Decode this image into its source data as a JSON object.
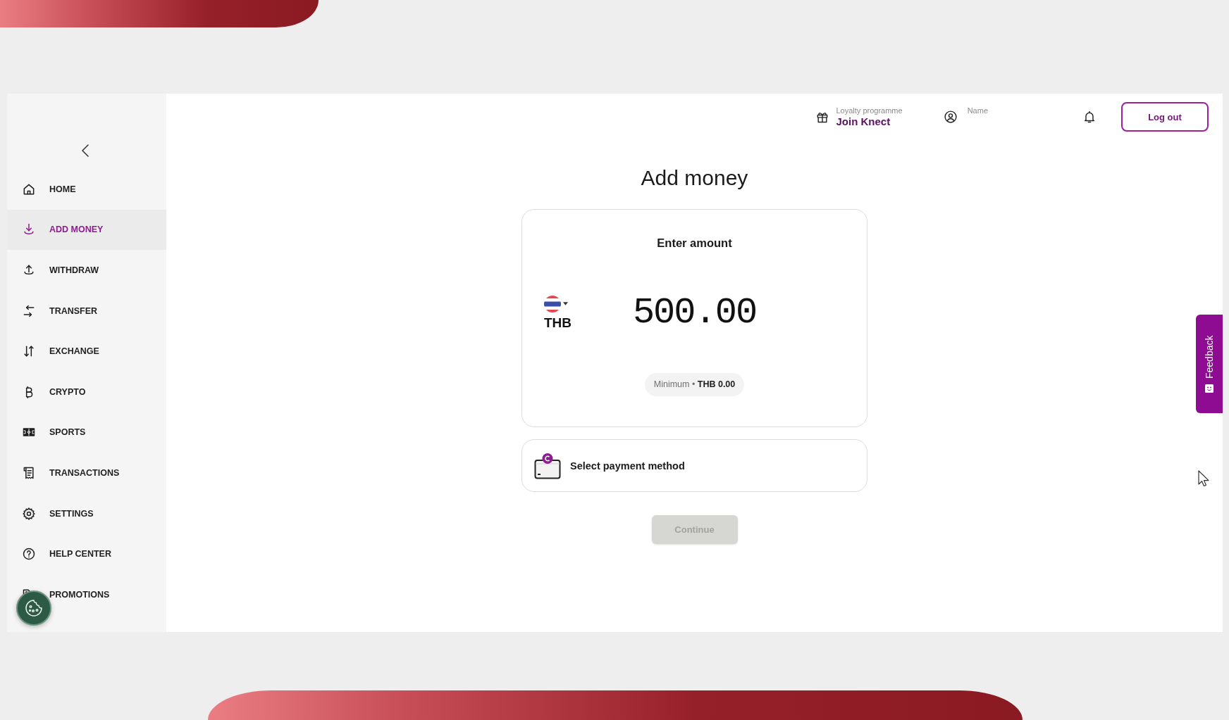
{
  "sidebar": {
    "items": [
      {
        "label": "HOME",
        "kind": "home",
        "selected": false
      },
      {
        "label": "ADD MONEY",
        "kind": "deposit",
        "selected": true
      },
      {
        "label": "WITHDRAW",
        "kind": "withdraw",
        "selected": false
      },
      {
        "label": "TRANSFER",
        "kind": "transfer",
        "selected": false
      },
      {
        "label": "EXCHANGE",
        "kind": "exchange",
        "selected": false
      },
      {
        "label": "CRYPTO",
        "kind": "crypto",
        "selected": false
      },
      {
        "label": "SPORTS",
        "kind": "sports",
        "selected": false
      },
      {
        "label": "TRANSACTIONS",
        "kind": "transactions",
        "selected": false
      },
      {
        "label": "SETTINGS",
        "kind": "settings",
        "selected": false
      },
      {
        "label": "HELP CENTER",
        "kind": "help",
        "selected": false
      },
      {
        "label": "PROMOTIONS",
        "kind": "promotions",
        "selected": false
      }
    ]
  },
  "header": {
    "loyalty": {
      "label": "Loyalty programme",
      "link": "Join Knect"
    },
    "user": {
      "label": "Name"
    },
    "logout_button": "Log out"
  },
  "page_title": "Add money",
  "amount_card": {
    "heading": "Enter amount",
    "currency": "THB",
    "amount": "500.00",
    "minimum": "Minimum • **THB 0.00**"
  },
  "payment_method": {
    "label": "Select payment method"
  },
  "continue_button": {
    "label": "Continue",
    "disabled": true
  },
  "feedback_tab": {
    "label": "Feedback"
  }
}
